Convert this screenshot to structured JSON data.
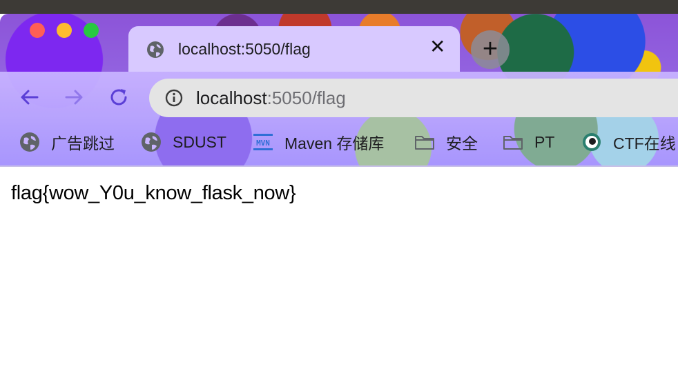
{
  "window": {
    "buttons": [
      "close-window",
      "minimize-window",
      "zoom-window"
    ]
  },
  "tab": {
    "title": "localhost:5050/flag",
    "close_glyph": "✕",
    "icon": "globe-icon"
  },
  "new_tab": {
    "glyph": "+"
  },
  "toolbar": {
    "back_icon": "back-arrow-icon",
    "forward_icon": "forward-arrow-icon",
    "reload_icon": "reload-icon"
  },
  "address_bar": {
    "host": "localhost",
    "path": ":5050/flag",
    "icon": "info-icon"
  },
  "bookmarks": [
    {
      "label": "广告跳过",
      "icon": "globe-icon"
    },
    {
      "label": "SDUST",
      "icon": "globe-icon"
    },
    {
      "label": "Maven 存储库",
      "icon": "maven-logo-icon"
    },
    {
      "label": "安全",
      "icon": "folder-icon"
    },
    {
      "label": "PT",
      "icon": "folder-icon"
    },
    {
      "label": "CTF在线",
      "icon": "ctf-logo-icon"
    }
  ],
  "page": {
    "body_text": "flag{wow_Y0u_know_flask_now}"
  },
  "colors": {
    "accent": "#5b3fd6",
    "traffic_red": "#ff5f57",
    "traffic_yellow": "#febc2e",
    "traffic_green": "#28c840"
  }
}
